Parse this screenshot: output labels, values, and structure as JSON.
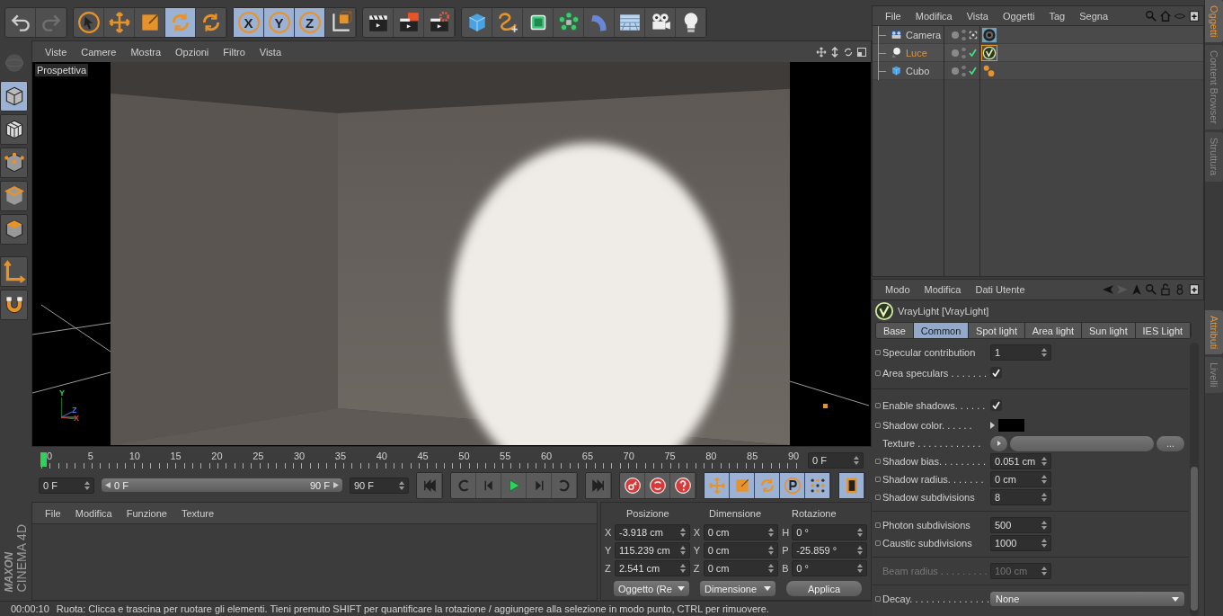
{
  "toolbar": {
    "groups": [
      [
        {
          "selected": false,
          "disabled": false
        },
        {
          "selected": false,
          "disabled": true
        }
      ],
      [
        {
          "selected": false
        },
        {
          "selected": false
        },
        {
          "selected": false
        },
        {
          "selected": true
        },
        {
          "selected": false
        }
      ],
      [
        {
          "label": "X",
          "selected": true
        },
        {
          "label": "Y",
          "selected": true
        },
        {
          "label": "Z",
          "selected": true
        },
        {
          "selected": false
        }
      ],
      [
        {
          "selected": false
        },
        {
          "selected": false
        },
        {
          "selected": false
        }
      ],
      [
        {
          "selected": false
        },
        {
          "selected": false
        },
        {
          "selected": false
        },
        {
          "selected": false
        },
        {
          "selected": false
        },
        {
          "selected": false
        },
        {
          "selected": false
        },
        {
          "selected": false
        }
      ]
    ]
  },
  "left_tools": [
    {
      "selected": false,
      "disabled": true
    },
    {
      "selected": true,
      "disabled": false
    },
    {
      "selected": false,
      "disabled": false
    },
    {
      "selected": false,
      "disabled": false
    },
    {
      "selected": false,
      "disabled": false
    },
    {
      "selected": false,
      "disabled": false
    },
    {
      "selected": false,
      "disabled": false
    },
    {
      "selected": false,
      "disabled": false
    }
  ],
  "logo": {
    "brand": "MAXON",
    "product": "CINEMA 4D"
  },
  "viewport": {
    "menu": [
      "Viste",
      "Camere",
      "Mostra",
      "Opzioni",
      "Filtro",
      "Vista"
    ],
    "camera_label": "Prospettiva",
    "axis_labels": [
      "Y",
      "Z",
      "X"
    ]
  },
  "timeline": {
    "ruler": [
      "0",
      "5",
      "10",
      "15",
      "20",
      "25",
      "30",
      "35",
      "40",
      "45",
      "50",
      "55",
      "60",
      "65",
      "70",
      "75",
      "80",
      "85",
      "90"
    ],
    "playhead": {
      "level": 0
    },
    "frame_field": "0 F",
    "start_field": "0 F",
    "range_slider": {
      "start": "0 F",
      "end": "90 F",
      "level": 1
    },
    "end_field": "90 F",
    "key_modes": [
      {
        "selected": true
      },
      {
        "selected": true
      },
      {
        "selected": true
      },
      {
        "selected": true
      },
      {
        "selected": true
      }
    ],
    "timeline_button": {
      "selected": true
    }
  },
  "materials": {
    "menu": [
      "File",
      "Modifica",
      "Funzione",
      "Texture"
    ]
  },
  "coordinates": {
    "headers": [
      "Posizione",
      "Dimensione",
      "Rotazione"
    ],
    "rows": [
      [
        {
          "axis": "X",
          "value": "-3.918 cm"
        },
        {
          "axis": "X",
          "value": "0 cm"
        },
        {
          "axis": "H",
          "value": "0 °"
        }
      ],
      [
        {
          "axis": "Y",
          "value": "115.239 cm"
        },
        {
          "axis": "Y",
          "value": "0 cm"
        },
        {
          "axis": "P",
          "value": "-25.859 °"
        }
      ],
      [
        {
          "axis": "Z",
          "value": "2.541 cm"
        },
        {
          "axis": "Z",
          "value": "0 cm"
        },
        {
          "axis": "B",
          "value": "0 °"
        }
      ]
    ],
    "mode_dropdown": "Oggetto (Re",
    "size_dropdown": "Dimensione",
    "apply_button": "Applica"
  },
  "status_bar": {
    "time": "00:00:10",
    "message": "Ruota: Clicca e trascina per ruotare gli elementi. Tieni premuto SHIFT per quantificare la rotazione / aggiungere alla selezione in modo punto, CTRL per rimuovere."
  },
  "objects": {
    "menu": [
      "File",
      "Modifica",
      "Vista",
      "Oggetti",
      "Tag",
      "Segna"
    ],
    "rows": [
      {
        "name": "Camera",
        "kind": "camera",
        "selected": false,
        "checked": false,
        "tag": {
          "kind": "lens",
          "selected": false
        }
      },
      {
        "name": "Luce",
        "kind": "light",
        "selected": true,
        "checked": true,
        "tag": {
          "kind": "vray",
          "selected": true
        }
      },
      {
        "name": "Cubo",
        "kind": "cube",
        "selected": false,
        "checked": true,
        "tag": {
          "kind": "spheres",
          "selected": false
        }
      }
    ]
  },
  "attributes": {
    "menu": [
      "Modo",
      "Modifica",
      "Dati Utente"
    ],
    "title": "VrayLight [VrayLight]",
    "tabs": [
      {
        "label": "Base",
        "selected": false
      },
      {
        "label": "Common",
        "selected": true
      },
      {
        "label": "Spot light",
        "selected": false
      },
      {
        "label": "Area light",
        "selected": false
      },
      {
        "label": "Sun light",
        "selected": false
      },
      {
        "label": "IES Light",
        "selected": false
      }
    ],
    "param_groups": [
      [
        {
          "kind": "number",
          "label": "Specular contribution",
          "value": "1",
          "keyframe_dot": true,
          "disabled": false
        },
        {
          "kind": "checkbox",
          "label": "Area speculars . . . . . . .",
          "checked": true,
          "keyframe_dot": true,
          "disabled": false
        }
      ],
      [
        {
          "kind": "checkbox",
          "label": "Enable shadows. . . . . .",
          "checked": true,
          "keyframe_dot": true,
          "disabled": false
        },
        {
          "kind": "color",
          "label": "Shadow color. . . . . .",
          "color": "#000000",
          "keyframe_dot": true,
          "disabled": false
        },
        {
          "kind": "texture",
          "label": "Texture . . . . . . . . . . . .",
          "button": "...",
          "keyframe_dot": false,
          "disabled": false
        },
        {
          "kind": "number",
          "label": "Shadow bias. . . . . . . . .",
          "value": "0.051 cm",
          "keyframe_dot": true,
          "disabled": false
        },
        {
          "kind": "number",
          "label": "Shadow radius. . . . . . .",
          "value": "0 cm",
          "keyframe_dot": true,
          "disabled": false
        },
        {
          "kind": "number",
          "label": "Shadow subdivisions",
          "value": "8",
          "keyframe_dot": true,
          "disabled": false
        }
      ],
      [
        {
          "kind": "number",
          "label": "Photon subdivisions",
          "value": "500",
          "keyframe_dot": true,
          "disabled": false
        },
        {
          "kind": "number",
          "label": "Caustic subdivisions",
          "value": "1000",
          "keyframe_dot": true,
          "disabled": false
        }
      ],
      [
        {
          "kind": "number",
          "label": "Beam radius . . . . . . . . .",
          "value": "100 cm",
          "keyframe_dot": false,
          "disabled": true
        }
      ],
      [
        {
          "kind": "dropdown",
          "label": "Decay. . . . . . . . . . . . . . .",
          "value": "None",
          "keyframe_dot": true,
          "disabled": false
        }
      ]
    ]
  },
  "side_tabs_upper": [
    {
      "label": "Oggetti",
      "selected": true
    },
    {
      "label": "Content Browser",
      "selected": false
    },
    {
      "label": "Struttura",
      "selected": false
    }
  ],
  "side_tabs_lower": [
    {
      "label": "Attributi",
      "selected": true
    },
    {
      "label": "Livelli",
      "selected": false
    }
  ]
}
